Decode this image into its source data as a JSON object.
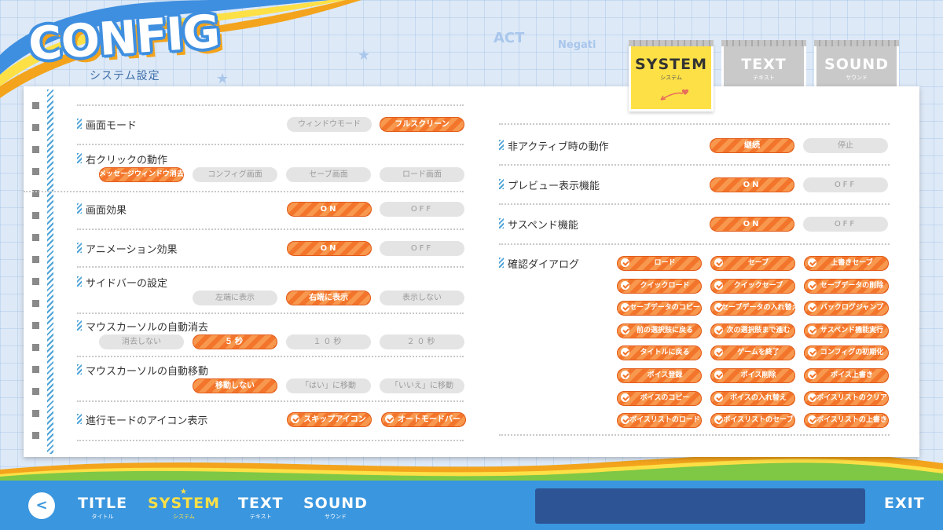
{
  "header": {
    "logo": "CONFIG",
    "subtitle": "システム設定"
  },
  "doodles": [
    "ACT",
    "Negati"
  ],
  "tabs": [
    {
      "label": "SYSTEM",
      "sub": "システム",
      "active": true
    },
    {
      "label": "TEXT",
      "sub": "テキスト",
      "active": false
    },
    {
      "label": "SOUND",
      "sub": "サウンド",
      "active": false
    }
  ],
  "left": {
    "screen_mode": {
      "label": "画面モード",
      "options": [
        "ウィンドウモード",
        "フルスクリーン"
      ],
      "selected": "フルスクリーン"
    },
    "right_click": {
      "label": "右クリックの動作",
      "options": [
        "メッセージウィンドウ消去",
        "コンフィグ画面",
        "セーブ画面",
        "ロード画面"
      ],
      "selected": "メッセージウィンドウ消去"
    },
    "screen_effect": {
      "label": "画面効果",
      "options": [
        "ON",
        "OFF"
      ],
      "selected": "ON"
    },
    "animation": {
      "label": "アニメーション効果",
      "options": [
        "ON",
        "OFF"
      ],
      "selected": "ON"
    },
    "sidebar": {
      "label": "サイドバーの設定",
      "options": [
        "左端に表示",
        "右端に表示",
        "表示しない"
      ],
      "selected": "右端に表示"
    },
    "cursor_hide": {
      "label": "マウスカーソルの自動消去",
      "options": [
        "消去しない",
        "５秒",
        "１０秒",
        "２０秒"
      ],
      "selected": "５秒"
    },
    "cursor_move": {
      "label": "マウスカーソルの自動移動",
      "options": [
        "移動しない",
        "「はい」に移動",
        "「いいえ」に移動"
      ],
      "selected": "移動しない"
    },
    "icon_display": {
      "label": "進行モードのアイコン表示",
      "options": [
        "スキップアイコン",
        "オートモードバー"
      ]
    }
  },
  "right": {
    "inactive": {
      "label": "非アクティブ時の動作",
      "options": [
        "継続",
        "停止"
      ],
      "selected": "継続"
    },
    "preview": {
      "label": "プレビュー表示機能",
      "options": [
        "ON",
        "OFF"
      ],
      "selected": "ON"
    },
    "suspend": {
      "label": "サスペンド機能",
      "options": [
        "ON",
        "OFF"
      ],
      "selected": "ON"
    },
    "confirm": {
      "label": "確認ダイアログ",
      "items": [
        "ロード",
        "セーブ",
        "上書きセーブ",
        "クイックロード",
        "クイックセーブ",
        "セーブデータの削除",
        "セーブデータのコピー",
        "セーブデータの入れ替え",
        "バックログジャンプ",
        "前の選択肢に戻る",
        "次の選択肢まで進む",
        "サスペンド機能実行",
        "タイトルに戻る",
        "ゲームを終了",
        "コンフィグの初期化",
        "ボイス登録",
        "ボイス削除",
        "ボイス上書き",
        "ボイスのコピー",
        "ボイスの入れ替え",
        "ボイスリストのクリア",
        "ボイスリストのロード",
        "ボイスリストのセーブ",
        "ボイスリストの上書き"
      ]
    }
  },
  "bottom_nav": [
    {
      "label": "TITLE",
      "sub": "タイトル",
      "active": false
    },
    {
      "label": "SYSTEM",
      "sub": "システム",
      "active": true
    },
    {
      "label": "TEXT",
      "sub": "テキスト",
      "active": false
    },
    {
      "label": "SOUND",
      "sub": "サウンド",
      "active": false
    }
  ],
  "exit_label": "EXIT",
  "back_glyph": "<",
  "colors": {
    "accent": "#f3752b",
    "active_tab": "#fde046",
    "bar": "#3a96de",
    "msgbox": "#2d5596"
  }
}
